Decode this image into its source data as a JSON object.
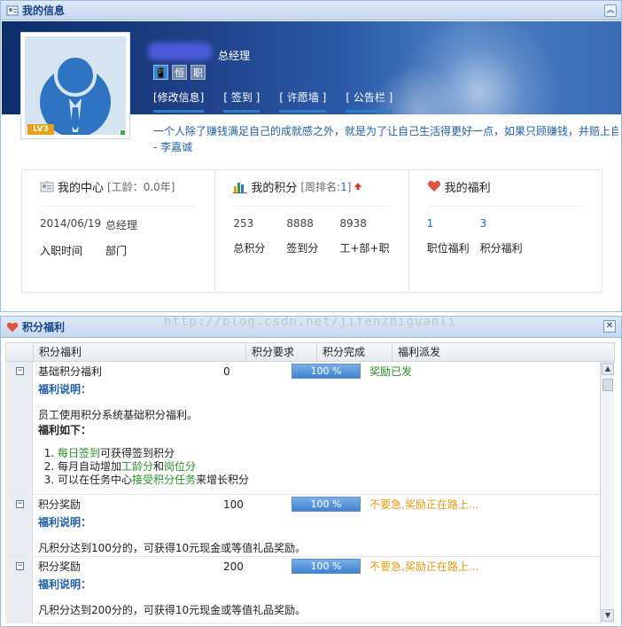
{
  "profile_panel": {
    "title": "我的信息",
    "collapse_icon": "double-chevron-up-icon",
    "role": "总经理",
    "level_badge": "LV3",
    "badges": [
      "📱",
      "恒",
      "职"
    ],
    "nav_links": [
      "[修改信息]",
      "[ 签到 ]",
      "[ 许愿墙 ]",
      "[ 公告栏 ]"
    ],
    "motto": "一个人除了赚钱满足自己的成就感之外，就是为了让自己生活得更好一点，如果只顾赚钱，并赔上自己",
    "motto_author": "- 李嘉诚"
  },
  "my_center": {
    "title": "我的中心",
    "sub": "[工龄：0.0年]",
    "values": [
      "2014/06/19",
      "总经理"
    ],
    "labels": [
      "入职时间",
      "部门"
    ]
  },
  "my_points": {
    "title": "我的积分",
    "rank_prefix": "[周排名:",
    "rank_value": "1",
    "rank_suffix": "]",
    "values": [
      "253",
      "8888",
      "8938"
    ],
    "labels": [
      "总积分",
      "签到分",
      "工+部+职"
    ]
  },
  "my_welfare": {
    "title": "我的福利",
    "values": [
      "1",
      "3"
    ],
    "labels": [
      "职位福利",
      "积分福利"
    ]
  },
  "welfare_panel": {
    "title": "积分福利",
    "close_icon": "close-icon",
    "columns": [
      "积分福利",
      "积分要求",
      "积分完成",
      "福利派发"
    ],
    "watermark": "http://blog.csdn.net/jifenzhiguanli"
  },
  "rows": [
    {
      "name": "基础积分福利",
      "requirement": "0",
      "progress": "100 %",
      "status": "奖励已发",
      "detail_label": "福利说明：",
      "detail_text": "员工使用积分系统基础积分福利。",
      "benefits_title": "福利如下：",
      "benefits": [
        {
          "a": "每日签到",
          "b": "可获得签到积分",
          "c": "",
          "d": ""
        },
        {
          "a": "每月自动增加",
          "b": "工龄分",
          "c": "和",
          "d": "岗位分"
        },
        {
          "a": "可以在任务中心",
          "b": "接受积分任务",
          "c": "来增长积分",
          "d": ""
        }
      ]
    },
    {
      "name": "积分奖励",
      "requirement": "100",
      "progress": "100 %",
      "status": "不要急,奖励正在路上...",
      "detail_label": "福利说明：",
      "detail_text": "凡积分达到100分的，可获得10元现金或等值礼品奖励。"
    },
    {
      "name": "积分奖励",
      "requirement": "200",
      "progress": "100 %",
      "status": "不要急,奖励正在路上...",
      "detail_label": "福利说明：",
      "detail_text": "凡积分达到200分的，可获得10元现金或等值礼品奖励。"
    }
  ]
}
